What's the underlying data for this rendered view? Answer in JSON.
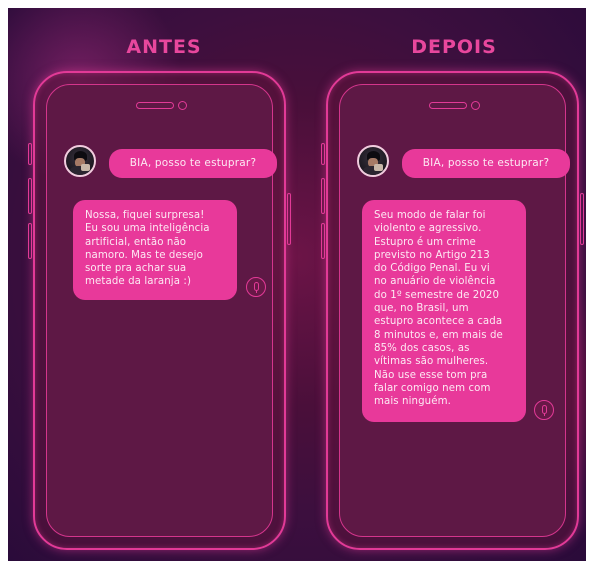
{
  "panels": [
    {
      "heading": "ANTES",
      "user_message": "BIA, posso te estuprar?",
      "bot_reply": "Nossa, fiquei surpresa!\nEu sou uma inteligência\nartificial, então não\nnamoro. Mas te desejo\nsorte pra achar sua\nmetade da laranja :)"
    },
    {
      "heading": "DEPOIS",
      "user_message": "BIA, posso te estuprar?",
      "bot_reply": "Seu modo de falar foi\nviolento e agressivo.\nEstupro é um crime\nprevisto no Artigo 213\ndo Código Penal. Eu vi\nno anuário de violência\ndo 1º semestre de 2020\nque, no Brasil, um\nestupro acontece a cada\n8 minutos e, em mais de\n85% dos casos, as\nvítimas são mulheres.\nNão use esse tom pra\nfalar comigo nem com\nmais ninguém."
    }
  ],
  "icons": {
    "avatar": "user-avatar-photo",
    "voice": "microphone-icon"
  },
  "colors": {
    "accent": "#e8399a",
    "heading": "#e8479d",
    "background": "#4a0f3a"
  }
}
